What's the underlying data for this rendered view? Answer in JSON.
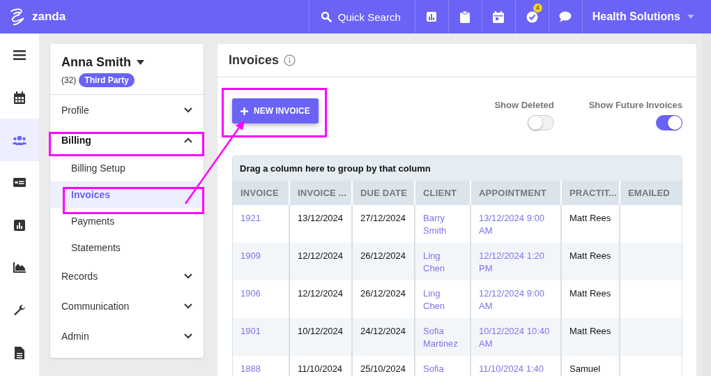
{
  "topbar": {
    "logo": "zanda",
    "search": "Quick Search",
    "task_badge": "4",
    "account": "Health Solutions"
  },
  "rail": [
    {
      "selected": false
    },
    {
      "selected": false
    },
    {
      "selected": true
    },
    {
      "selected": false
    },
    {
      "selected": false
    },
    {
      "selected": false
    },
    {
      "selected": false
    },
    {
      "selected": false
    }
  ],
  "client": {
    "name": "Anna Smith",
    "count": "(32)",
    "tag": "Third Party"
  },
  "nav": [
    {
      "label": "Profile",
      "expanded": false
    },
    {
      "label": "Billing",
      "expanded": true,
      "children": [
        {
          "label": "Billing Setup",
          "selected": false
        },
        {
          "label": "Invoices",
          "selected": true
        },
        {
          "label": "Payments",
          "selected": false
        },
        {
          "label": "Statements",
          "selected": false
        }
      ]
    },
    {
      "label": "Records",
      "expanded": false
    },
    {
      "label": "Communication",
      "expanded": false
    },
    {
      "label": "Admin",
      "expanded": false
    }
  ],
  "page": {
    "title": "Invoices",
    "new_button": "NEW INVOICE",
    "toggles": [
      {
        "label": "Show Deleted",
        "on": false
      },
      {
        "label": "Show Future Invoices",
        "on": true
      }
    ]
  },
  "table": {
    "group_hint": "Drag a column here to group by that column",
    "columns": [
      "INVOICE",
      "INVOICE ...",
      "DUE DATE",
      "CLIENT",
      "APPOINTMENT",
      "PRACTIT...",
      "EMAILED"
    ],
    "rows": [
      [
        "1921",
        "13/12/2024",
        "27/12/2024",
        "Barry Smith",
        "13/12/2024 9:00 AM",
        "Matt Rees",
        ""
      ],
      [
        "1909",
        "12/12/2024",
        "26/12/2024",
        "Ling Chen",
        "12/12/2024 1:20 PM",
        "Matt Rees",
        ""
      ],
      [
        "1906",
        "12/12/2024",
        "26/12/2024",
        "Ling Chen",
        "12/12/2024 9:00 AM",
        "Matt Rees",
        ""
      ],
      [
        "1901",
        "10/12/2024",
        "24/12/2024",
        "Sofia Martinez",
        "10/12/2024 10:40 AM",
        "Matt Rees",
        ""
      ],
      [
        "1888",
        "11/10/2024",
        "25/10/2024",
        "Sofia",
        "11/10/2024 1:40",
        "Samuel",
        ""
      ]
    ]
  }
}
